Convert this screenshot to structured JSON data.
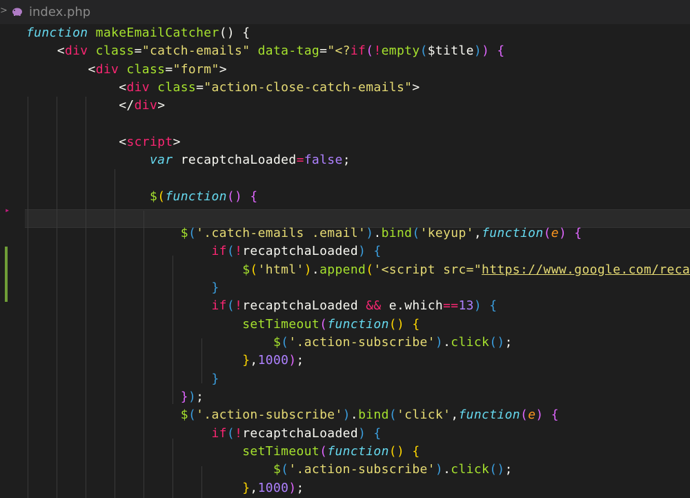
{
  "tab": {
    "chevron": ">",
    "icon": "php-elephant-icon",
    "filename": "index.php"
  },
  "lines": [
    [
      [
        "function",
        "t-kw"
      ],
      [
        " makeEmailCatcher",
        "t-fn"
      ],
      [
        "()",
        "t-pun"
      ],
      [
        " {",
        "t-pun"
      ]
    ],
    [
      [
        "    <",
        "t-pun"
      ],
      [
        "div",
        "t-tag"
      ],
      [
        " class",
        "t-attr"
      ],
      [
        "=",
        "t-pun"
      ],
      [
        "\"catch-emails\"",
        "t-str"
      ],
      [
        " data-tag",
        "t-attr"
      ],
      [
        "=",
        "t-pun"
      ],
      [
        "\"<?",
        "t-str"
      ],
      [
        "if",
        "t-ctl"
      ],
      [
        "(",
        "t-b2"
      ],
      [
        "!",
        "t-op"
      ],
      [
        "empty",
        "t-fn"
      ],
      [
        "(",
        "t-b3"
      ],
      [
        "$title",
        "t-var"
      ],
      [
        ")",
        "t-b3"
      ],
      [
        ")",
        "t-b2"
      ],
      [
        " {",
        "t-b2"
      ]
    ],
    [
      [
        "        <",
        "t-pun"
      ],
      [
        "div",
        "t-tag"
      ],
      [
        " class",
        "t-attr"
      ],
      [
        "=",
        "t-pun"
      ],
      [
        "\"form\"",
        "t-str"
      ],
      [
        ">",
        "t-pun"
      ]
    ],
    [
      [
        "            <",
        "t-pun"
      ],
      [
        "div",
        "t-tag"
      ],
      [
        " class",
        "t-attr"
      ],
      [
        "=",
        "t-pun"
      ],
      [
        "\"action-close-catch-emails\"",
        "t-str"
      ],
      [
        ">",
        "t-pun"
      ]
    ],
    [
      [
        "            </",
        "t-pun"
      ],
      [
        "div",
        "t-tag"
      ],
      [
        ">",
        "t-pun"
      ]
    ],
    [],
    [
      [
        "            <",
        "t-pun"
      ],
      [
        "script",
        "t-tag"
      ],
      [
        ">",
        "t-pun"
      ]
    ],
    [
      [
        "                ",
        "t-pun"
      ],
      [
        "var",
        "t-sto"
      ],
      [
        " recaptchaLoaded",
        "t-var"
      ],
      [
        "=",
        "t-op"
      ],
      [
        "false",
        "t-bool"
      ],
      [
        ";",
        "t-pun"
      ]
    ],
    [],
    [
      [
        "                ",
        "t-pun"
      ],
      [
        "$",
        "t-fn"
      ],
      [
        "(",
        "t-b4"
      ],
      [
        "function",
        "t-kw"
      ],
      [
        "()",
        "t-b2"
      ],
      [
        " {",
        "t-b2"
      ]
    ],
    [],
    [
      [
        "                    ",
        "t-pun"
      ],
      [
        "$",
        "t-fn"
      ],
      [
        "(",
        "t-b3"
      ],
      [
        "'.catch-emails .email'",
        "t-str"
      ],
      [
        ")",
        "t-b3"
      ],
      [
        ".",
        "t-pun"
      ],
      [
        "bind",
        "t-fn"
      ],
      [
        "(",
        "t-b3"
      ],
      [
        "'keyup'",
        "t-str"
      ],
      [
        ",",
        "t-pun"
      ],
      [
        "function",
        "t-kw"
      ],
      [
        "(",
        "t-b2"
      ],
      [
        "e",
        "t-par"
      ],
      [
        ")",
        "t-b2"
      ],
      [
        " {",
        "t-b2"
      ]
    ],
    [
      [
        "                        ",
        "t-pun"
      ],
      [
        "if",
        "t-ctl"
      ],
      [
        "(",
        "t-b3"
      ],
      [
        "!",
        "t-op"
      ],
      [
        "recaptchaLoaded",
        "t-var"
      ],
      [
        ")",
        "t-b3"
      ],
      [
        " {",
        "t-b3"
      ]
    ],
    [
      [
        "                            ",
        "t-pun"
      ],
      [
        "$",
        "t-fn"
      ],
      [
        "(",
        "t-b4"
      ],
      [
        "'html'",
        "t-str"
      ],
      [
        ")",
        "t-b4"
      ],
      [
        ".",
        "t-pun"
      ],
      [
        "append",
        "t-fn"
      ],
      [
        "(",
        "t-b4"
      ],
      [
        "'<script src=\"",
        "t-str"
      ],
      [
        "https://www.google.com/recaptcha",
        "t-lnk"
      ]
    ],
    [
      [
        "                        ",
        "t-pun"
      ],
      [
        "}",
        "t-b3"
      ]
    ],
    [
      [
        "                        ",
        "t-pun"
      ],
      [
        "if",
        "t-ctl"
      ],
      [
        "(",
        "t-b3"
      ],
      [
        "!",
        "t-op"
      ],
      [
        "recaptchaLoaded",
        "t-var"
      ],
      [
        " &&",
        "t-op"
      ],
      [
        " e",
        "t-var"
      ],
      [
        ".",
        "t-pun"
      ],
      [
        "which",
        "t-var"
      ],
      [
        "==",
        "t-op"
      ],
      [
        "13",
        "t-num"
      ],
      [
        ")",
        "t-b3"
      ],
      [
        " {",
        "t-b3"
      ]
    ],
    [
      [
        "                            ",
        "t-pun"
      ],
      [
        "setTimeout",
        "t-fn"
      ],
      [
        "(",
        "t-b2"
      ],
      [
        "function",
        "t-kw"
      ],
      [
        "()",
        "t-b4"
      ],
      [
        " {",
        "t-b4"
      ]
    ],
    [
      [
        "                                ",
        "t-pun"
      ],
      [
        "$",
        "t-fn"
      ],
      [
        "(",
        "t-b3"
      ],
      [
        "'.action-subscribe'",
        "t-str"
      ],
      [
        ")",
        "t-b3"
      ],
      [
        ".",
        "t-pun"
      ],
      [
        "click",
        "t-fn"
      ],
      [
        "()",
        "t-b3"
      ],
      [
        ";",
        "t-pun"
      ]
    ],
    [
      [
        "                            ",
        "t-pun"
      ],
      [
        "}",
        "t-b4"
      ],
      [
        ",",
        "t-pun"
      ],
      [
        "1000",
        "t-num"
      ],
      [
        ")",
        "t-b2"
      ],
      [
        ";",
        "t-pun"
      ]
    ],
    [
      [
        "                        ",
        "t-pun"
      ],
      [
        "}",
        "t-b3"
      ]
    ],
    [
      [
        "                    ",
        "t-pun"
      ],
      [
        "}",
        "t-b2"
      ],
      [
        ")",
        "t-b3"
      ],
      [
        ";",
        "t-pun"
      ]
    ],
    [
      [
        "                    ",
        "t-pun"
      ],
      [
        "$",
        "t-fn"
      ],
      [
        "(",
        "t-b3"
      ],
      [
        "'.action-subscribe'",
        "t-str"
      ],
      [
        ")",
        "t-b3"
      ],
      [
        ".",
        "t-pun"
      ],
      [
        "bind",
        "t-fn"
      ],
      [
        "(",
        "t-b3"
      ],
      [
        "'click'",
        "t-str"
      ],
      [
        ",",
        "t-pun"
      ],
      [
        "function",
        "t-kw"
      ],
      [
        "(",
        "t-b2"
      ],
      [
        "e",
        "t-par"
      ],
      [
        ")",
        "t-b2"
      ],
      [
        " {",
        "t-b2"
      ]
    ],
    [
      [
        "                        ",
        "t-pun"
      ],
      [
        "if",
        "t-ctl"
      ],
      [
        "(",
        "t-b3"
      ],
      [
        "!",
        "t-op"
      ],
      [
        "recaptchaLoaded",
        "t-var"
      ],
      [
        ")",
        "t-b3"
      ],
      [
        " {",
        "t-b3"
      ]
    ],
    [
      [
        "                            ",
        "t-pun"
      ],
      [
        "setTimeout",
        "t-fn"
      ],
      [
        "(",
        "t-b2"
      ],
      [
        "function",
        "t-kw"
      ],
      [
        "()",
        "t-b4"
      ],
      [
        " {",
        "t-b4"
      ]
    ],
    [
      [
        "                                ",
        "t-pun"
      ],
      [
        "$",
        "t-fn"
      ],
      [
        "(",
        "t-b3"
      ],
      [
        "'.action-subscribe'",
        "t-str"
      ],
      [
        ")",
        "t-b3"
      ],
      [
        ".",
        "t-pun"
      ],
      [
        "click",
        "t-fn"
      ],
      [
        "()",
        "t-b3"
      ],
      [
        ";",
        "t-pun"
      ]
    ],
    [
      [
        "                            ",
        "t-pun"
      ],
      [
        "}",
        "t-b4"
      ],
      [
        ",",
        "t-pun"
      ],
      [
        "1000",
        "t-num"
      ],
      [
        ")",
        "t-b2"
      ],
      [
        ";",
        "t-pun"
      ]
    ]
  ]
}
